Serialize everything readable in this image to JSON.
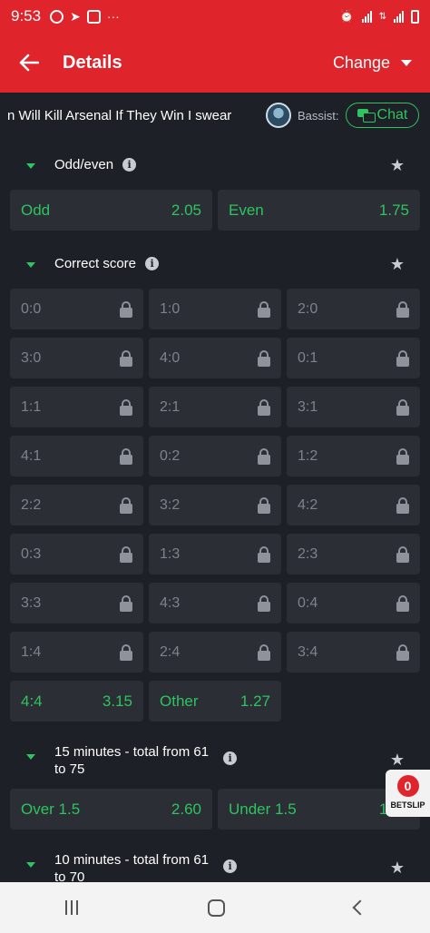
{
  "status_bar": {
    "time": "9:53",
    "more": "···"
  },
  "header": {
    "title": "Details",
    "change_label": "Change"
  },
  "ticker": {
    "text": "n Will Kill Arsenal If They Win I swear",
    "username": "Bassist:",
    "chat_label": "Chat"
  },
  "odd_even": {
    "title": "Odd/even",
    "options": [
      {
        "label": "Odd",
        "odds": "2.05"
      },
      {
        "label": "Even",
        "odds": "1.75"
      }
    ]
  },
  "correct_score": {
    "title": "Correct score",
    "locked_scores": [
      "0:0",
      "1:0",
      "2:0",
      "3:0",
      "4:0",
      "0:1",
      "1:1",
      "2:1",
      "3:1",
      "4:1",
      "0:2",
      "1:2",
      "2:2",
      "3:2",
      "4:2",
      "0:3",
      "1:3",
      "2:3",
      "3:3",
      "4:3",
      "0:4",
      "1:4",
      "2:4",
      "3:4"
    ],
    "open": [
      {
        "label": "4:4",
        "odds": "3.15"
      },
      {
        "label": "Other",
        "odds": "1.27"
      }
    ]
  },
  "fifteen_minutes": {
    "title_line1": "15 minutes - total from 61",
    "title_line2": "to 75",
    "options": [
      {
        "label": "Over 1.5",
        "odds": "2.60"
      },
      {
        "label": "Under 1.5",
        "odds": "1.46"
      }
    ]
  },
  "ten_minutes": {
    "title_line1": "10 minutes - total from 61",
    "title_line2": "to 70"
  },
  "betslip": {
    "count": "0",
    "label": "BETSLIP"
  },
  "icons": {
    "back": "arrow-left-icon",
    "dropdown": "caret-down-icon",
    "info": "info-icon",
    "star": "star-icon",
    "lock": "lock-icon",
    "chat": "chat-icon",
    "expand": "triangle-down-icon"
  },
  "colors": {
    "brand_red": "#e0242c",
    "accent_green": "#2ec45f",
    "background": "#1d2026",
    "cell": "#2b2e35"
  }
}
